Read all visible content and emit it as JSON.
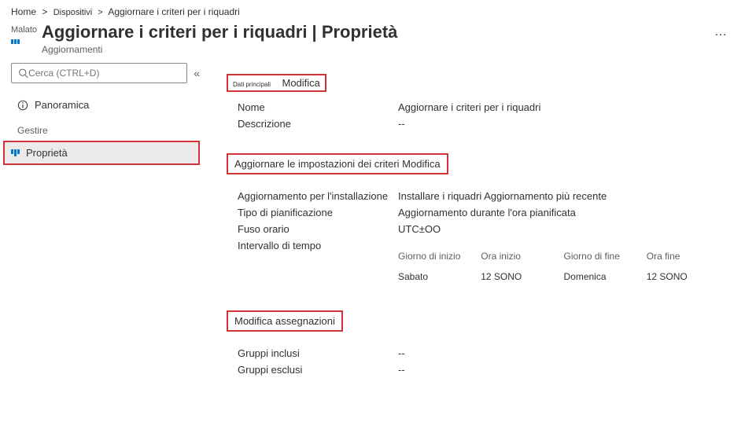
{
  "breadcrumb": {
    "home": "Home",
    "sep": ">",
    "devices": "Dispositivi",
    "current": "Aggiornare i criteri per i riquadri"
  },
  "header": {
    "badge": "Malato",
    "title": "Aggiornare i criteri per i riquadri | Proprietà",
    "subtitle": "Aggiornamenti",
    "more": "…"
  },
  "sidebar": {
    "search_placeholder": "Cerca (CTRL+D)",
    "collapse": "«",
    "overview": "Panoramica",
    "manage_section": "Gestire",
    "properties": "Proprietà"
  },
  "basics": {
    "tiny": "Dati principali",
    "edit": "Modifica",
    "name_label": "Nome",
    "name_value": "Aggiornare i criteri per i riquadri",
    "desc_label": "Descrizione",
    "desc_value": "--"
  },
  "settings": {
    "heading": "Aggiornare le impostazioni dei criteri Modifica",
    "install_label": "Aggiornamento per l'installazione",
    "install_value": "Installare i riquadri Aggiornamento più recente",
    "schedule_type_label": "Tipo di pianificazione",
    "schedule_type_value": "Aggiornamento durante l'ora pianificata",
    "tz_label": "Fuso orario",
    "tz_value": "UTC±OO",
    "window_label": "Intervallo di tempo",
    "table": {
      "h_startday": "Giorno di inizio",
      "h_starttime": "Ora inizio",
      "h_endday": "Giorno di fine",
      "h_endtime": "Ora fine",
      "r_startday": "Sabato",
      "r_starttime": "12 SONO",
      "r_endday": "Domenica",
      "r_endtime": "12 SONO"
    }
  },
  "assignments": {
    "heading": "Modifica assegnazioni",
    "included_label": "Gruppi inclusi",
    "included_value": "--",
    "excluded_label": "Gruppi esclusi",
    "excluded_value": "--"
  }
}
